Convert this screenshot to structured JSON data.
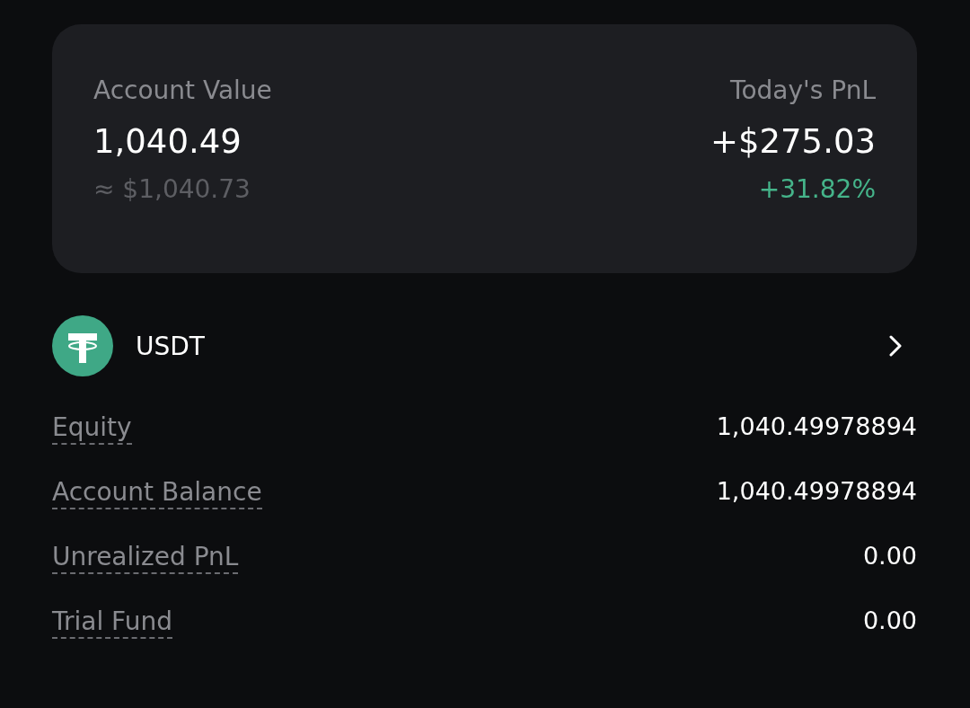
{
  "summary": {
    "account_value": {
      "label": "Account Value",
      "value": "1,040.49",
      "approx": "≈ $1,040.73"
    },
    "todays_pnl": {
      "label": "Today's PnL",
      "value": "+$275.03",
      "change": "+31.82%"
    }
  },
  "asset": {
    "name": "USDT"
  },
  "details": [
    {
      "label": "Equity",
      "value": "1,040.49978894"
    },
    {
      "label": "Account Balance",
      "value": "1,040.49978894"
    },
    {
      "label": "Unrealized PnL",
      "value": "0.00"
    },
    {
      "label": "Trial Fund",
      "value": "0.00"
    }
  ]
}
